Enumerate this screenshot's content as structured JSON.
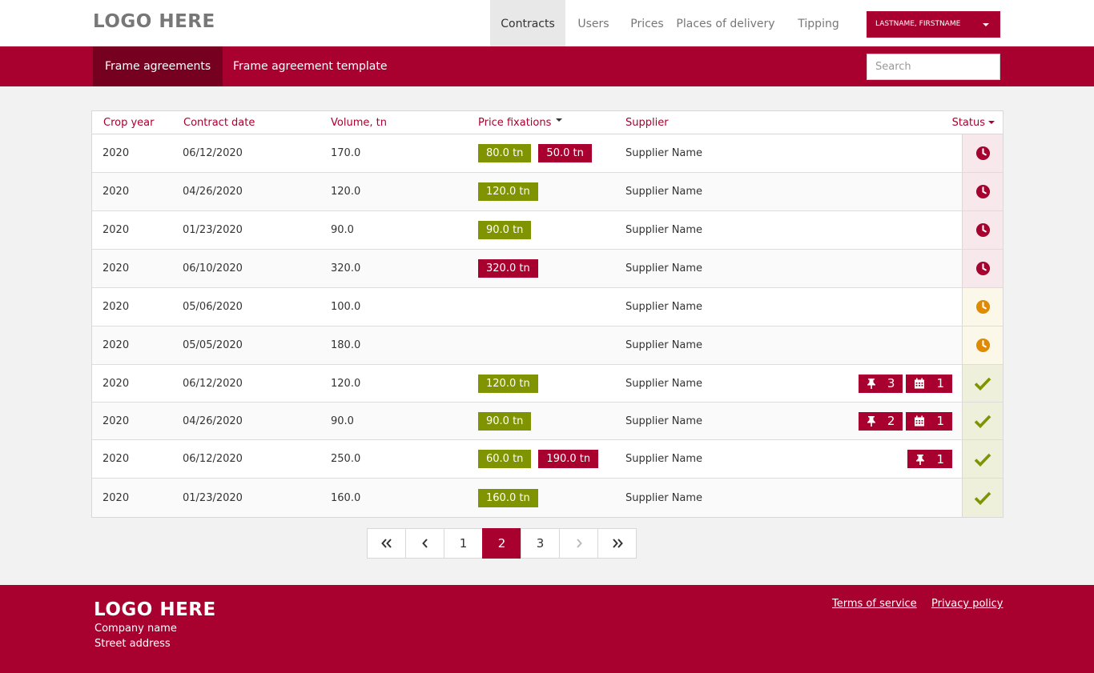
{
  "header": {
    "logo": "LOGO HERE",
    "nav": [
      {
        "label": "Contracts",
        "active": true
      },
      {
        "label": "Users",
        "active": false
      },
      {
        "label": "Prices",
        "active": false
      },
      {
        "label": "Places of delivery",
        "active": false
      },
      {
        "label": "Tipping",
        "active": false
      }
    ],
    "user": "LASTNAME, FIRSTNAME"
  },
  "subnav": {
    "tabs": [
      {
        "label": "Frame agreements",
        "active": true
      },
      {
        "label": "Frame agreement template",
        "active": false
      }
    ],
    "search_placeholder": "Search"
  },
  "table": {
    "columns": {
      "crop_year": "Crop year",
      "contract_date": "Contract date",
      "volume": "Volume, tn",
      "price_fixations": "Price fixations",
      "supplier": "Supplier",
      "status": "Status"
    },
    "rows": [
      {
        "crop_year": "2020",
        "date": "06/12/2020",
        "volume": "170.0",
        "fix": [
          {
            "label": "80.0 tn",
            "color": "green"
          },
          {
            "label": "50.0 tn",
            "color": "red"
          }
        ],
        "supplier": "Supplier Name",
        "tags": [],
        "status": "pending"
      },
      {
        "crop_year": "2020",
        "date": "04/26/2020",
        "volume": "120.0",
        "fix": [
          {
            "label": "120.0 tn",
            "color": "green"
          }
        ],
        "supplier": "Supplier Name",
        "tags": [],
        "status": "pending"
      },
      {
        "crop_year": "2020",
        "date": "01/23/2020",
        "volume": "90.0",
        "fix": [
          {
            "label": "90.0 tn",
            "color": "green"
          }
        ],
        "supplier": "Supplier Name",
        "tags": [],
        "status": "pending"
      },
      {
        "crop_year": "2020",
        "date": "06/10/2020",
        "volume": "320.0",
        "fix": [
          {
            "label": "320.0 tn",
            "color": "red"
          }
        ],
        "supplier": "Supplier Name",
        "tags": [],
        "status": "pending"
      },
      {
        "crop_year": "2020",
        "date": "05/06/2020",
        "volume": "100.0",
        "fix": [],
        "supplier": "Supplier Name",
        "tags": [],
        "status": "waiting"
      },
      {
        "crop_year": "2020",
        "date": "05/05/2020",
        "volume": "180.0",
        "fix": [],
        "supplier": "Supplier Name",
        "tags": [],
        "status": "waiting"
      },
      {
        "crop_year": "2020",
        "date": "06/12/2020",
        "volume": "120.0",
        "fix": [
          {
            "label": "120.0 tn",
            "color": "green"
          }
        ],
        "supplier": "Supplier Name",
        "tags": [
          {
            "icon": "pin-icon",
            "count": "3"
          },
          {
            "icon": "calendar-icon",
            "count": "1"
          }
        ],
        "status": "done"
      },
      {
        "crop_year": "2020",
        "date": "04/26/2020",
        "volume": "90.0",
        "fix": [
          {
            "label": "90.0 tn",
            "color": "green"
          }
        ],
        "supplier": "Supplier Name",
        "tags": [
          {
            "icon": "pin-icon",
            "count": "2"
          },
          {
            "icon": "calendar-icon",
            "count": "1"
          }
        ],
        "status": "done"
      },
      {
        "crop_year": "2020",
        "date": "06/12/2020",
        "volume": "250.0",
        "fix": [
          {
            "label": "60.0 tn",
            "color": "green"
          },
          {
            "label": "190.0 tn",
            "color": "red"
          }
        ],
        "supplier": "Supplier Name",
        "tags": [
          {
            "icon": "pin-icon",
            "count": "1"
          }
        ],
        "status": "done"
      },
      {
        "crop_year": "2020",
        "date": "01/23/2020",
        "volume": "160.0",
        "fix": [
          {
            "label": "160.0 tn",
            "color": "green"
          }
        ],
        "supplier": "Supplier Name",
        "tags": [],
        "status": "done"
      }
    ]
  },
  "pagination": {
    "pages": [
      "1",
      "2",
      "3"
    ],
    "current": "2"
  },
  "footer": {
    "logo": "LOGO HERE",
    "company": "Company name",
    "address": "Street address",
    "links": {
      "terms": "Terms of service",
      "privacy": "Privacy policy"
    }
  },
  "colors": {
    "brand": "#a8002f",
    "brand_dark": "#75001f",
    "fix_green": "#7f9400",
    "status_pending": "#a8002f",
    "status_waiting": "#e08a00",
    "status_done": "#7f9400"
  }
}
